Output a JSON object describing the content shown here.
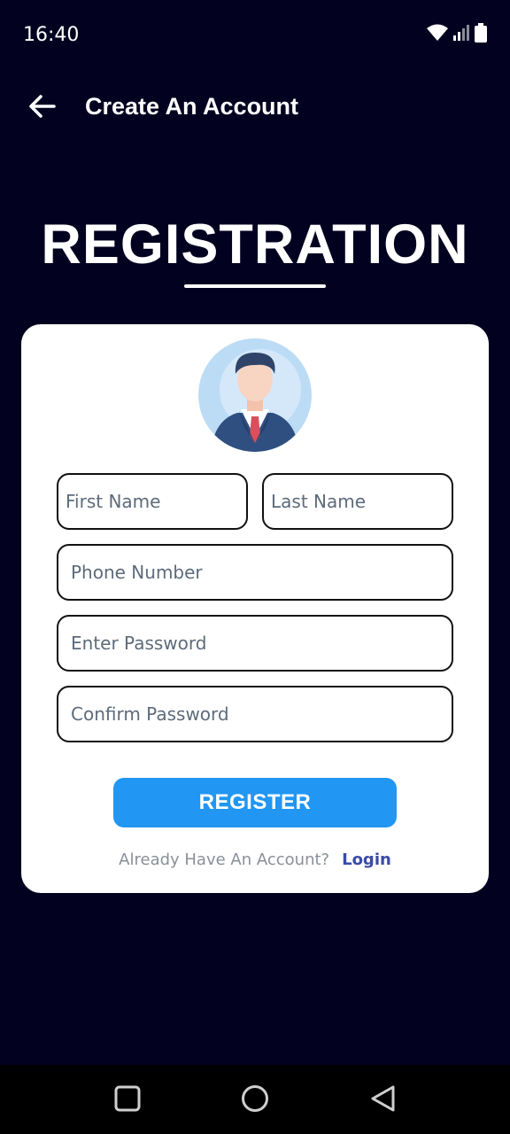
{
  "status_bar": {
    "time": "16:40",
    "icons": [
      "wifi-icon",
      "signal-icon",
      "battery-icon"
    ]
  },
  "app_bar": {
    "back_icon": "arrow-left-icon",
    "title": "Create An Account"
  },
  "heading": "REGISTRATION",
  "form": {
    "avatar_icon": "businessman-avatar-icon",
    "first_name": {
      "placeholder": "First Name",
      "value": ""
    },
    "last_name": {
      "placeholder": "Last Name",
      "value": ""
    },
    "phone": {
      "placeholder": "Phone Number",
      "value": ""
    },
    "password": {
      "placeholder": "Enter Password",
      "value": ""
    },
    "confirm_password": {
      "placeholder": "Confirm Password",
      "value": ""
    },
    "register_label": "REGISTER",
    "footer_text": "Already Have An Account?",
    "login_label": "Login"
  },
  "nav_bar": {
    "icons": [
      "recents-square-icon",
      "home-circle-icon",
      "back-triangle-icon"
    ]
  },
  "colors": {
    "background": "#020220",
    "card": "#ffffff",
    "accent": "#2196f3",
    "link": "#3a4aa8"
  }
}
